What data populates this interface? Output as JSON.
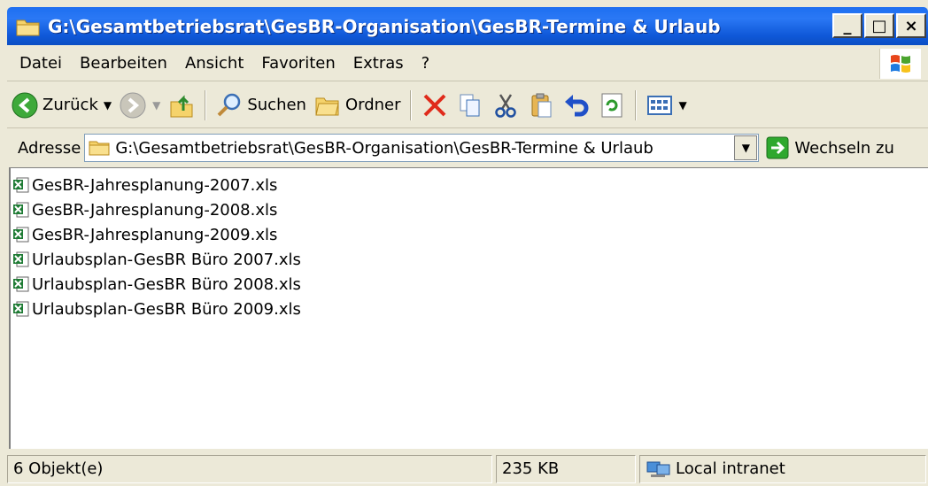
{
  "window": {
    "title": "G:\\Gesamtbetriebsrat\\GesBR-Organisation\\GesBR-Termine & Urlaub"
  },
  "window_buttons": {
    "minimize": "_",
    "maximize": "□",
    "close": "×"
  },
  "menu": [
    "Datei",
    "Bearbeiten",
    "Ansicht",
    "Favoriten",
    "Extras",
    "?"
  ],
  "toolbar": {
    "back_label": "Zurück",
    "search_label": "Suchen",
    "folders_label": "Ordner"
  },
  "address": {
    "label": "Adresse",
    "value": "G:\\Gesamtbetriebsrat\\GesBR-Organisation\\GesBR-Termine & Urlaub",
    "go_label": "Wechseln zu"
  },
  "files": [
    "GesBR-Jahresplanung-2007.xls",
    "GesBR-Jahresplanung-2008.xls",
    "GesBR-Jahresplanung-2009.xls",
    "Urlaubsplan-GesBR Büro 2007.xls",
    "Urlaubsplan-GesBR Büro 2008.xls",
    "Urlaubsplan-GesBR Büro 2009.xls"
  ],
  "status": {
    "count": "6 Objekt(e)",
    "size": "235 KB",
    "zone": "Local intranet"
  },
  "icons": [
    "folder-icon",
    "back-arrow-icon",
    "forward-arrow-icon",
    "up-folder-icon",
    "search-icon",
    "folders-icon",
    "delete-icon",
    "copy-icon",
    "cut-icon",
    "paste-icon",
    "undo-icon",
    "refresh-icon",
    "views-icon",
    "go-arrow-icon",
    "excel-file-icon",
    "intranet-icon",
    "windows-logo-icon"
  ],
  "colors": {
    "titlebar": "#0f58d8",
    "chrome": "#ece9d8",
    "list_bg": "#ffffff"
  }
}
